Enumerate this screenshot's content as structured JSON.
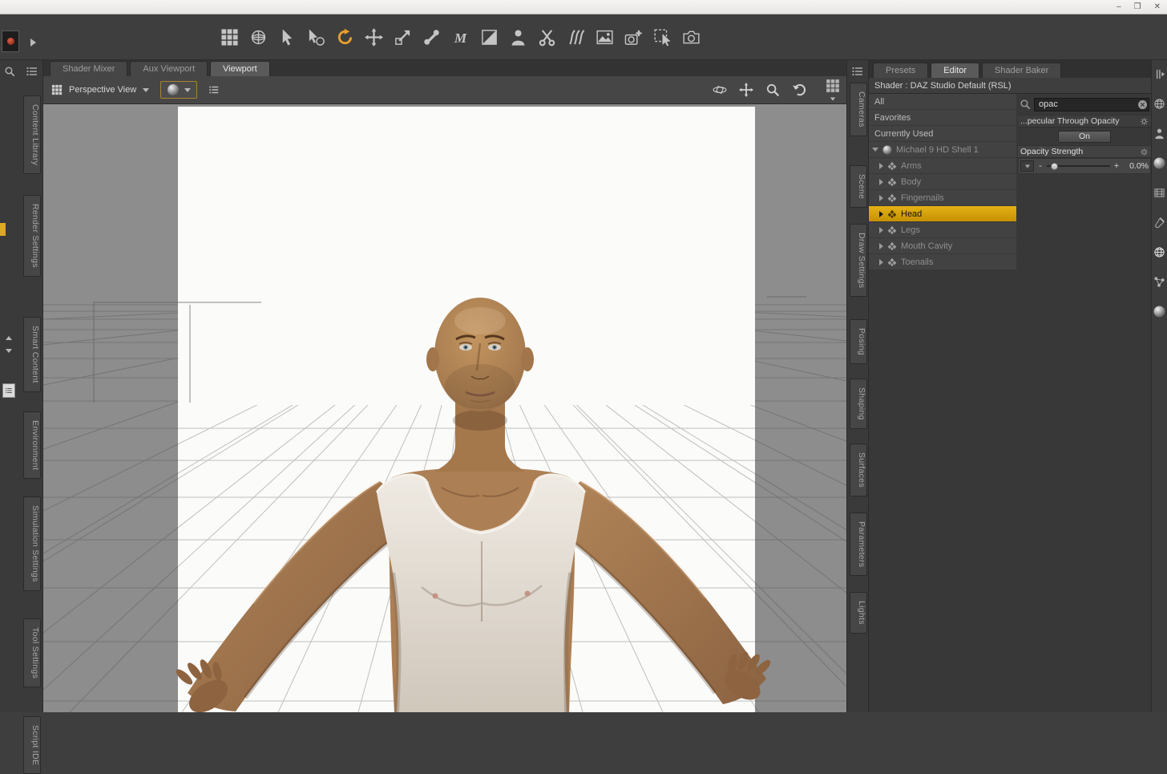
{
  "window": {
    "controls": {
      "minimize": "–",
      "maximize": "❒",
      "close": "✕"
    }
  },
  "colors": {
    "selection_gold": "#D8A312",
    "active_tool_orange": "#E8A02E",
    "panel_bg": "#3E3E3E",
    "viewport_bg": "#8D8D8D"
  },
  "toolbar": {
    "tools": [
      "scene-navigator",
      "universal-tool",
      "node-selection",
      "rotate-cursor",
      "active-rotate-tool",
      "translate-tool",
      "scale-tool",
      "joint-editor",
      "measure-metrics",
      "surface-selection",
      "figure-setup",
      "geometry-editor",
      "hair-tool",
      "region-navigator",
      "create-camera",
      "spot-render",
      "render-camera"
    ],
    "active_tool": "active-rotate-tool"
  },
  "left_tabs": [
    "Content Library",
    "Render Settings",
    "Smart Content",
    "Environment",
    "Simulation Settings",
    "Tool Settings",
    "Script IDE"
  ],
  "center": {
    "tabs": [
      {
        "label": "Shader Mixer",
        "active": false
      },
      {
        "label": "Aux Viewport",
        "active": false
      },
      {
        "label": "Viewport",
        "active": true
      }
    ],
    "viewport_toolbar": {
      "view_selector": "Perspective View"
    }
  },
  "right_tabs": [
    "Cameras",
    "Scene",
    "Draw Settings",
    "Posing",
    "Shaping",
    "Surfaces",
    "Parameters",
    "Lights"
  ],
  "surfaces_panel": {
    "tabs": [
      {
        "label": "Presets",
        "active": false
      },
      {
        "label": "Editor",
        "active": true
      },
      {
        "label": "Shader Baker",
        "active": false
      }
    ],
    "shader_label": "Shader : DAZ Studio Default (RSL)",
    "filters": [
      "All",
      "Favorites",
      "Currently Used"
    ],
    "tree_root": "Michael 9 HD Shell 1",
    "tree_children": [
      "Arms",
      "Body",
      "Fingernails",
      "Head",
      "Legs",
      "Mouth Cavity",
      "Toenails"
    ],
    "selected_child": "Head",
    "editor": {
      "search_value": "opac",
      "group_label": "...pecular Through Opacity",
      "toggle_label": "On",
      "property_label": "Opacity Strength",
      "property_value": "0.0%",
      "slider_minus": "-",
      "slider_plus": "+"
    }
  }
}
